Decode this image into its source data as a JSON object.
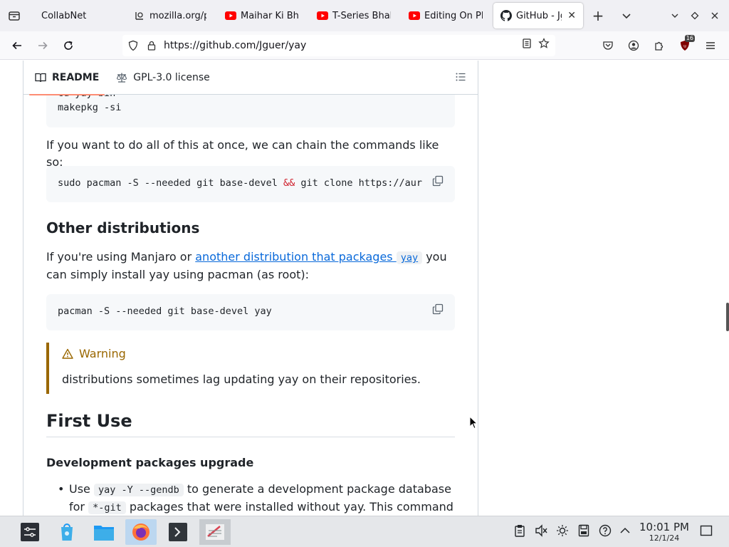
{
  "browser": {
    "tabs": [
      {
        "title": "CollabNet",
        "icon": "collabnet-icon",
        "active": false
      },
      {
        "title": "mozilla.org/p",
        "icon": "mozilla-icon",
        "active": false
      },
      {
        "title": "Maihar Ki Bh",
        "icon": "youtube-icon",
        "active": false
      },
      {
        "title": "T-Series Bhak",
        "icon": "youtube-icon",
        "active": false
      },
      {
        "title": "Editing On Pl",
        "icon": "youtube-icon",
        "active": false
      },
      {
        "title": "GitHub - Jg",
        "icon": "github-icon",
        "active": true
      }
    ],
    "url": "https://github.com/Jguer/yay",
    "extension_badge": "16",
    "colors": {
      "youtube": "#ff0000",
      "tab_bar_bg": "#f0f0f4"
    }
  },
  "readme_header": {
    "readme_tab": "README",
    "license_tab": "GPL-3.0 license"
  },
  "content": {
    "code_block_1": {
      "line1": "cd yay-bin",
      "line2": "makepkg -si"
    },
    "para_chain": "If you want to do all of this at once, we can chain the commands like so:",
    "code_block_2": {
      "part1": "sudo pacman -S --needed git base-devel ",
      "amp": "&&",
      "part2": " git clone https://aur"
    },
    "h_other_distributions": "Other distributions",
    "para_manjaro": {
      "before": "If you're using Manjaro or ",
      "link_text": "another distribution that packages ",
      "link_code": "yay",
      "after": " you can simply install yay using pacman (as root):"
    },
    "code_block_3": "pacman -S --needed git base-devel yay",
    "warning": {
      "title": "Warning",
      "body": "distributions sometimes lag updating yay on their repositories."
    },
    "h_first_use": "First Use",
    "h_dev_packages": "Development packages upgrade",
    "list_item": {
      "w1": "Use ",
      "code1": "yay -Y --gendb",
      "w2": " to generate a development package database for ",
      "code2": "*-git",
      "w3": " packages that were installed without yay. This command should"
    },
    "warning_color": "#9a6700",
    "link_color": "#0969da"
  },
  "taskbar": {
    "apps": [
      "application-menu-icon",
      "discover-icon",
      "file-manager-icon",
      "firefox-icon",
      "terminal-icon",
      "text-editor-icon"
    ],
    "tray": [
      "clipboard-icon",
      "volume-muted-icon",
      "brightness-icon",
      "storage-icon",
      "help-icon",
      "expand-tray-icon"
    ],
    "time": "10:01 PM",
    "date": "12/1/24"
  }
}
